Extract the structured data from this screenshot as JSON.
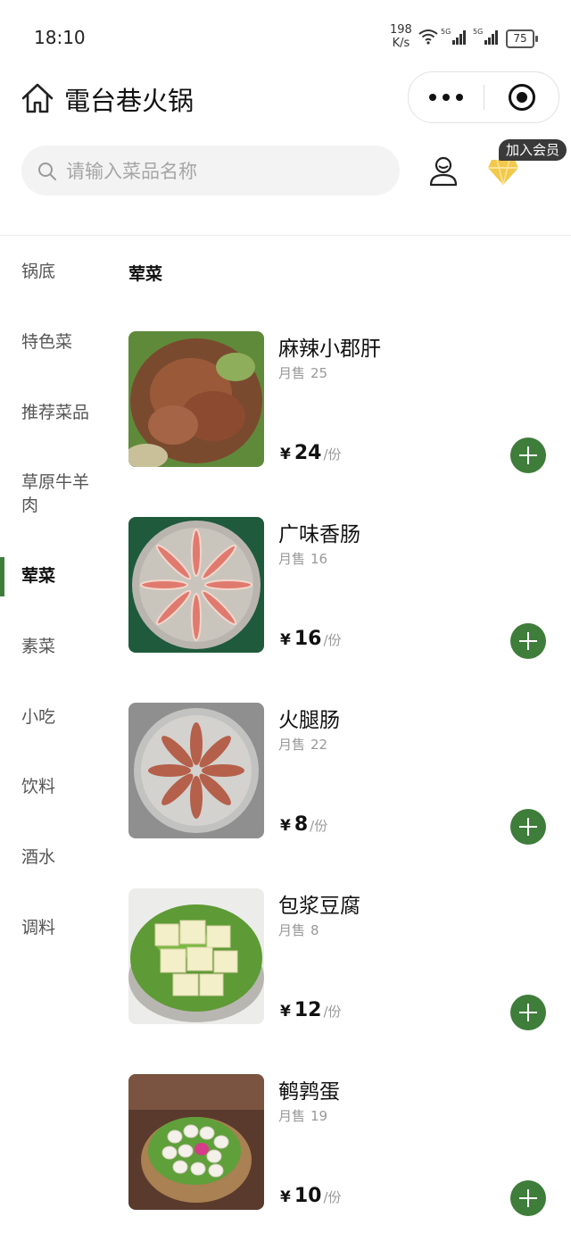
{
  "status_bar": {
    "time": "18:10",
    "net_speed_value": "198",
    "net_speed_unit": "K/s",
    "battery": "75"
  },
  "navbar": {
    "title": "電台巷火锅"
  },
  "search": {
    "placeholder": "请输入菜品名称",
    "value": ""
  },
  "member_badge": "加入会员",
  "categories": [
    {
      "label": "锅底",
      "active": false
    },
    {
      "label": "特色菜",
      "active": false
    },
    {
      "label": "推荐菜品",
      "active": false
    },
    {
      "label": "草原牛羊肉",
      "active": false
    },
    {
      "label": "荤菜",
      "active": true
    },
    {
      "label": "素菜",
      "active": false
    },
    {
      "label": "小吃",
      "active": false
    },
    {
      "label": "饮料",
      "active": false
    },
    {
      "label": "酒水",
      "active": false
    },
    {
      "label": "调料",
      "active": false
    }
  ],
  "section_title": "荤菜",
  "currency": "¥",
  "unit": "/份",
  "sales_label": "月售",
  "items": [
    {
      "name": "麻辣小郡肝",
      "sales": "25",
      "price": "24"
    },
    {
      "name": "广味香肠",
      "sales": "16",
      "price": "16"
    },
    {
      "name": "火腿肠",
      "sales": "22",
      "price": "8"
    },
    {
      "name": "包浆豆腐",
      "sales": "8",
      "price": "12"
    },
    {
      "name": "鹌鹑蛋",
      "sales": "19",
      "price": "10"
    }
  ],
  "colors": {
    "accent": "#3e7d3a",
    "vip_gold": "#f2c94c",
    "badge_bg": "#3a3a3a"
  },
  "icons": {
    "home": "home-icon",
    "more": "more-dots-icon",
    "close": "target-close-icon",
    "search": "search-icon",
    "user": "user-icon",
    "vip": "diamond-icon",
    "add": "plus-icon"
  }
}
